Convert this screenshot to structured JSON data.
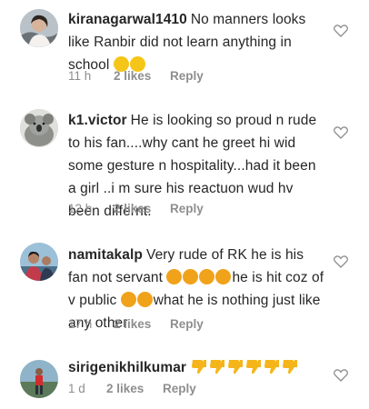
{
  "comments": [
    {
      "username": "kiranagarwal1410",
      "text": "No manners looks like Ranbir did not learn anything in school",
      "emojis": [
        "grinning-sweat",
        "grinning-sweat"
      ],
      "time": "11 h",
      "likes": "2 likes",
      "reply": "Reply"
    },
    {
      "username": "k1.victor",
      "text": "He is looking so proud n rude to his fan....why cant he greet hi wid some gesture n hospitality...had it been a girl ..i m sure his reactuon wud hv been differnt.",
      "time": "12 h",
      "likes": "2 likes",
      "reply": "Reply"
    },
    {
      "username": "namitakalp",
      "text_a": "Very rude of RK he is his fan not servant",
      "text_b": "he is hit coz of v public",
      "text_c": "what he is nothing just like any other",
      "emojis_a": [
        "angry-face",
        "angry-face",
        "angry-face",
        "angry-face"
      ],
      "emojis_b": [
        "angry-face",
        "angry-face"
      ],
      "time": "17 h",
      "likes": "2 likes",
      "reply": "Reply"
    },
    {
      "username": "sirigenikhilkumar",
      "emojis": [
        "thumbs-down",
        "thumbs-down",
        "thumbs-down",
        "thumbs-down",
        "thumbs-down",
        "thumbs-down"
      ],
      "time": "1 d",
      "likes": "2 likes",
      "reply": "Reply"
    }
  ],
  "colors": {
    "text": "#262626",
    "meta": "#8e8e8e",
    "emoji_yellow": "#f5c518",
    "emoji_orange": "#f0a21a"
  },
  "icons": {
    "like": "heart-outline-icon"
  }
}
